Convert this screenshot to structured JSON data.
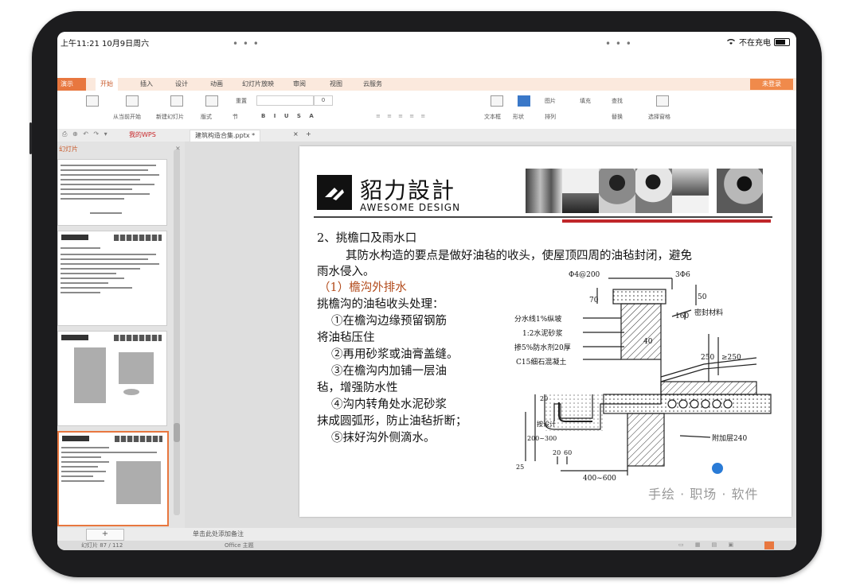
{
  "status_bar": {
    "time": "上午11:21  10月9日周六",
    "right_text": "不在充电",
    "icons": [
      "wifi-icon",
      "battery-icon"
    ]
  },
  "ribbon": {
    "app_label": "演示",
    "tabs": [
      "开始",
      "插入",
      "设计",
      "动画",
      "幻灯片放映",
      "审阅",
      "视图",
      "云服务"
    ],
    "login_label": "未登录"
  },
  "toolbar": {
    "from_current": "从当前开始",
    "new_slide": "新建幻灯片",
    "layout": "版式",
    "section": "节",
    "reset": "重置",
    "text_box": "文本框",
    "shape": "形状",
    "arrange": "排列",
    "picture": "图片",
    "fill": "填充",
    "find": "查找",
    "replace": "替换",
    "select_pane": "选择窗格",
    "font_size": "0"
  },
  "doc_tabs": {
    "home_tab": "我的WPS",
    "file_tab": "建筑构造合集.pptx *",
    "add": "+"
  },
  "left_panel": {
    "title": "幻灯片",
    "close": "×"
  },
  "notes_bar": {
    "add_label": "+",
    "placeholder": "单击此处添加备注"
  },
  "app_status": {
    "slide_count": "幻灯片 87 / 112",
    "theme": "Office 主题"
  },
  "slide": {
    "brand_cn": "貂力設計",
    "brand_en": "AWESOME DESIGN",
    "heading": "2、挑檐口及雨水口",
    "intro_line1": "其防水构造的要点是做好油毡的收头，使屋顶四周的油毡封闭，避免",
    "intro_line2": "雨水侵入。",
    "subheading": "（1）檐沟外排水",
    "lines": [
      "挑檐沟的油毡收头处理：",
      "①在檐沟边缘预留钢筋",
      "将油毡压住",
      "②再用砂浆或油膏盖缝。",
      "③在檐沟内加铺一层油",
      "毡，增强防水性",
      "④沟内转角处水泥砂浆",
      "抹成圆弧形，防止油毡折断；",
      "⑤抹好沟外侧滴水。"
    ],
    "drawing_labels": {
      "rebar_top": "Φ4@200",
      "rebar_right": "3Φ6",
      "dim_70": "70",
      "dim_50": "50",
      "dim_160": "160",
      "seal": "密封材料",
      "slope": "分水线1%纵坡",
      "mortar": "1:2水泥砂浆",
      "waterproof": "掺5%防水剂20厚",
      "concrete": "C15细石混凝土",
      "dim_40": "40",
      "dim_250": "250",
      "dim_250b": "≥250",
      "dim_200_300": "200~300",
      "dim_20_1": "20",
      "dim_25": "25",
      "design": "按设计",
      "extra_layer": "附加层240",
      "dim_20_2": "20",
      "dim_60": "60",
      "dim_400_600": "400~600"
    },
    "watermark": "手绘 · 职场 · 软件"
  }
}
